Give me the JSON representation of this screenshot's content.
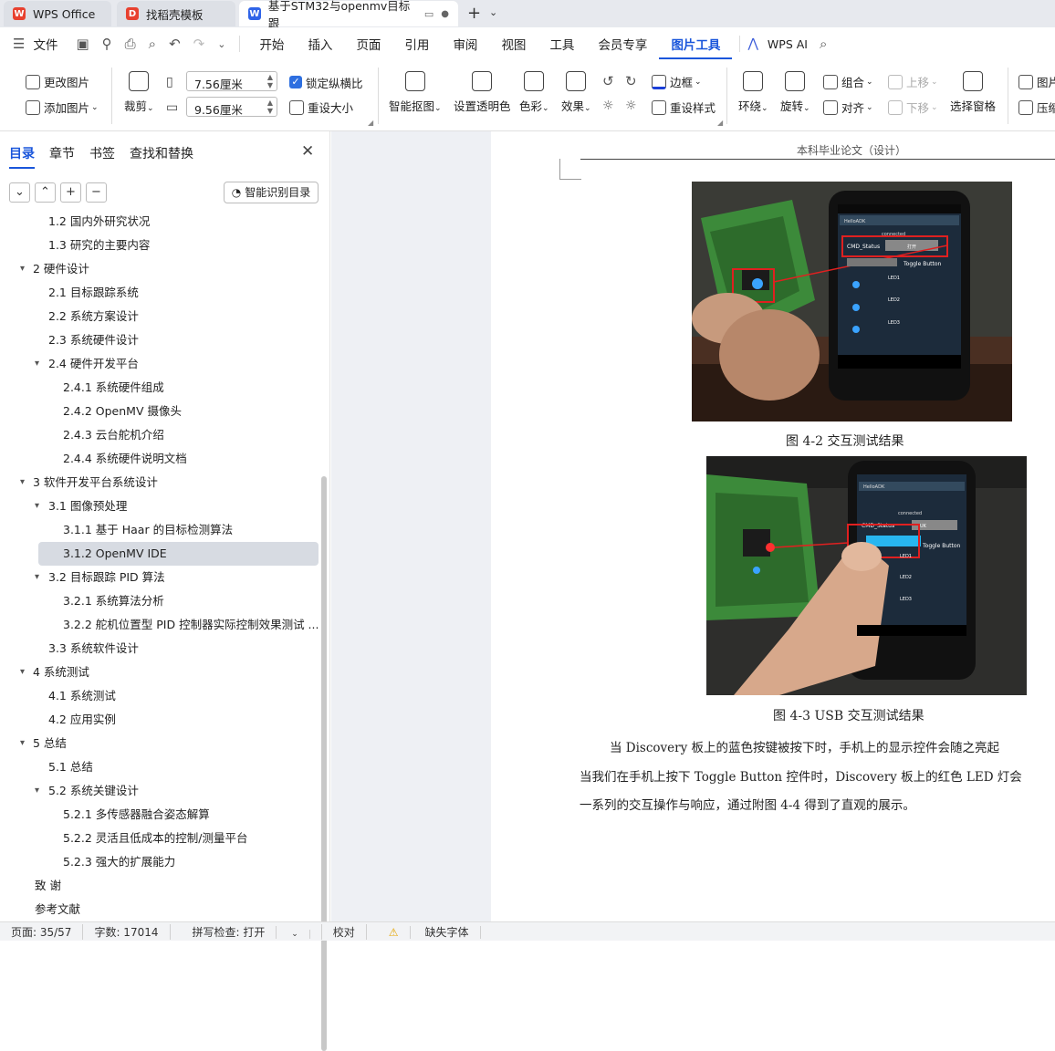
{
  "tabs": [
    {
      "label": "WPS Office"
    },
    {
      "label": "找稻壳模板"
    },
    {
      "label": "基于STM32与openmv目标跟"
    }
  ],
  "menu": {
    "file": "文件",
    "items": [
      "开始",
      "插入",
      "页面",
      "引用",
      "审阅",
      "视图",
      "工具",
      "会员专享",
      "图片工具"
    ],
    "ai": "WPS AI"
  },
  "ribbon": {
    "change_pic": "更改图片",
    "add_pic": "添加图片",
    "crop": "裁剪",
    "height": "7.56厘米",
    "width": "9.56厘米",
    "lock": "锁定纵横比",
    "reset_size": "重设大小",
    "smart_cut": "智能抠图",
    "transparent": "设置透明色",
    "color": "色彩",
    "effect": "效果",
    "border": "边框",
    "reset_style": "重设样式",
    "wrap": "环绕",
    "rotate": "旋转",
    "group": "组合",
    "align": "对齐",
    "up": "上移",
    "down": "下移",
    "select_pane": "选择窗格",
    "pic": "图片",
    "compress": "压缩"
  },
  "sidebar": {
    "tabs": [
      "目录",
      "章节",
      "书签",
      "查找和替换"
    ],
    "smart_toc": "智能识别目录",
    "toc": [
      {
        "t": "1.2  国内外研究状况",
        "lvl": 2,
        "arrow": ""
      },
      {
        "t": "1.3  研究的主要内容",
        "lvl": 2,
        "arrow": ""
      },
      {
        "t": "2  硬件设计",
        "lvl": 1,
        "arrow": "▾"
      },
      {
        "t": "2.1  目标跟踪系统",
        "lvl": 2,
        "arrow": ""
      },
      {
        "t": "2.2  系统方案设计",
        "lvl": 2,
        "arrow": ""
      },
      {
        "t": "2.3 系统硬件设计",
        "lvl": 2,
        "arrow": ""
      },
      {
        "t": "2.4  硬件开发平台",
        "lvl": 2,
        "arrow": "▾"
      },
      {
        "t": "2.4.1  系统硬件组成",
        "lvl": 3,
        "arrow": ""
      },
      {
        "t": "2.4.2 OpenMV 摄像头",
        "lvl": 3,
        "arrow": ""
      },
      {
        "t": "2.4.3  云台舵机介绍",
        "lvl": 3,
        "arrow": ""
      },
      {
        "t": "2.4.4  系统硬件说明文档",
        "lvl": 3,
        "arrow": ""
      },
      {
        "t": "3  软件开发平台系统设计",
        "lvl": 1,
        "arrow": "▾"
      },
      {
        "t": "3.1  图像预处理",
        "lvl": 2,
        "arrow": "▾"
      },
      {
        "t": "3.1.1  基于 Haar 的目标检测算法",
        "lvl": 3,
        "arrow": ""
      },
      {
        "t": "3.1.2 OpenMV IDE",
        "lvl": 3,
        "arrow": "",
        "hl": true
      },
      {
        "t": "3.2  目标跟踪 PID 算法",
        "lvl": 2,
        "arrow": "▾"
      },
      {
        "t": "3.2.1  系统算法分析",
        "lvl": 3,
        "arrow": ""
      },
      {
        "t": "3.2.2  舵机位置型 PID 控制器实际控制效果测试 ...",
        "lvl": 3,
        "arrow": ""
      },
      {
        "t": "3.3  系统软件设计",
        "lvl": 2,
        "arrow": ""
      },
      {
        "t": "4 系统测试",
        "lvl": 1,
        "arrow": "▾"
      },
      {
        "t": "4.1  系统测试",
        "lvl": 2,
        "arrow": ""
      },
      {
        "t": "4.2  应用实例",
        "lvl": 2,
        "arrow": ""
      },
      {
        "t": "5  总结",
        "lvl": 1,
        "arrow": "▾"
      },
      {
        "t": "5.1 总结",
        "lvl": 2,
        "arrow": ""
      },
      {
        "t": "5.2 系统关键设计",
        "lvl": 2,
        "arrow": "▾"
      },
      {
        "t": "5.2.1 多传感器融合姿态解算",
        "lvl": 3,
        "arrow": ""
      },
      {
        "t": "5.2.2 灵活且低成本的控制/测量平台",
        "lvl": 3,
        "arrow": ""
      },
      {
        "t": "5.2.3 强大的扩展能力",
        "lvl": 3,
        "arrow": ""
      },
      {
        "t": "致  谢",
        "lvl": 0,
        "arrow": ""
      },
      {
        "t": "参考文献",
        "lvl": 0,
        "arrow": ""
      }
    ]
  },
  "doc": {
    "header": "本科毕业论文（设计）",
    "cap1": "图 4-2  交互测试结果",
    "cap2": "图 4-3 USB 交互测试结果",
    "p1": "当 Discovery 板上的蓝色按键被按下时，手机上的显示控件会随之亮起",
    "p2": "当我们在手机上按下 Toggle Button 控件时，Discovery 板上的红色 LED 灯会",
    "p3": "一系列的交互操作与响应，通过附图 4-4 得到了直观的展示。",
    "phone1": {
      "status": "connected",
      "cmd": "CMD_Status",
      "btn": "打开",
      "toggle": "Toggle Button",
      "led1": "LED1",
      "led2": "LED2",
      "led3": "LED3",
      "app": "HelloADK"
    },
    "phone2": {
      "status": "connected",
      "cmd": "CMD_Status",
      "btn": "UK",
      "toggle": "Toggle Button",
      "led1": "LED1",
      "led2": "LED2",
      "led3": "LED3",
      "app": "HelloADK"
    }
  },
  "status": {
    "page": "页面: 35/57",
    "words": "字数: 17014",
    "spell": "拼写检查: 打开",
    "proof": "校对",
    "font": "缺失字体"
  },
  "colors": {
    "accent": "#1a56db",
    "wps_red": "#e8412f",
    "led_blue": "#3aa3ff"
  }
}
